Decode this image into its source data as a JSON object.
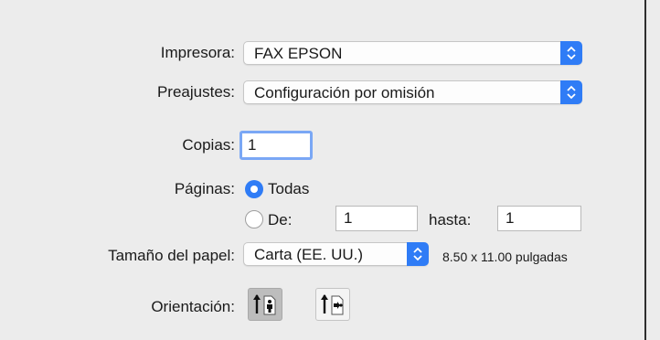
{
  "printer": {
    "label": "Impresora:",
    "value": "FAX EPSON"
  },
  "presets": {
    "label": "Preajustes:",
    "value": "Configuración por omisión"
  },
  "copies": {
    "label": "Copias:",
    "value": "1"
  },
  "pages": {
    "label": "Páginas:",
    "all_label": "Todas",
    "from_label": "De:",
    "from_value": "1",
    "to_label": "hasta:",
    "to_value": "1",
    "selected": "all"
  },
  "paper_size": {
    "label": "Tamaño del papel:",
    "value": "Carta (EE. UU.)",
    "dimensions": "8.50 x 11.00 pulgadas"
  },
  "orientation": {
    "label": "Orientación:",
    "selected": "portrait"
  },
  "colors": {
    "accent": "#2f7cf6",
    "background": "#ececec",
    "focus_ring": "#7aa7f5"
  }
}
